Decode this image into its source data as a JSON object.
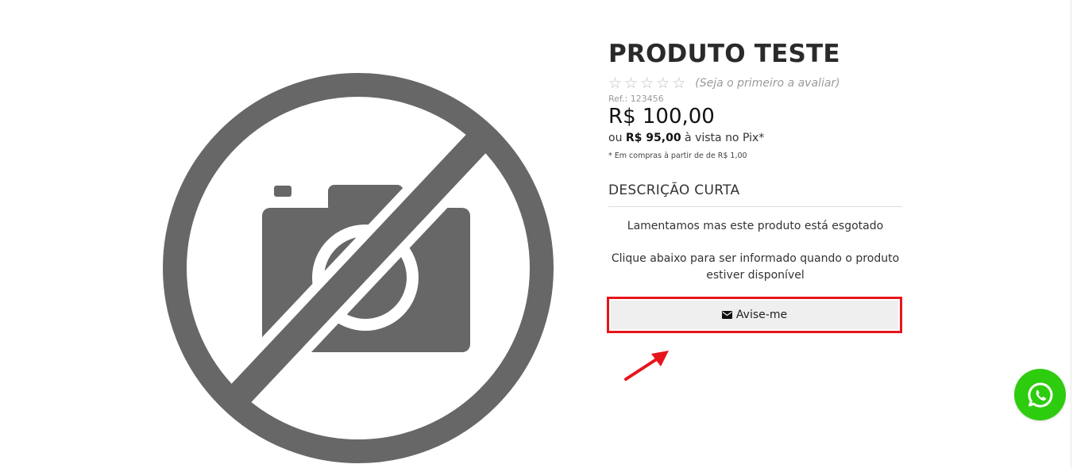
{
  "product": {
    "title": "PRODUTO TESTE",
    "stars": [
      "☆",
      "☆",
      "☆",
      "☆",
      "☆"
    ],
    "rating_text": "(Seja o primeiro a avaliar)",
    "ref": "Ref.: 123456",
    "price": "R$ 100,00",
    "pix_prefix": "ou",
    "pix_price": "R$ 95,00",
    "pix_suffix": "à vista no Pix*",
    "pix_note": "* Em compras à partir de de R$ 1,00"
  },
  "description": {
    "title": "DESCRIÇÃO CURTA",
    "out_of_stock": "Lamentamos mas este produto está esgotado",
    "notify_info": "Clique abaixo para ser informado quando o produto estiver disponível"
  },
  "notify_button": {
    "label": "Avise-me",
    "icon": "mail-icon",
    "highlight_color": "#e8141b"
  },
  "image": {
    "icon": "no-photo-icon",
    "color": "#676767"
  },
  "whatsapp": {
    "icon": "whatsapp-icon",
    "color": "#2ecc0f"
  }
}
